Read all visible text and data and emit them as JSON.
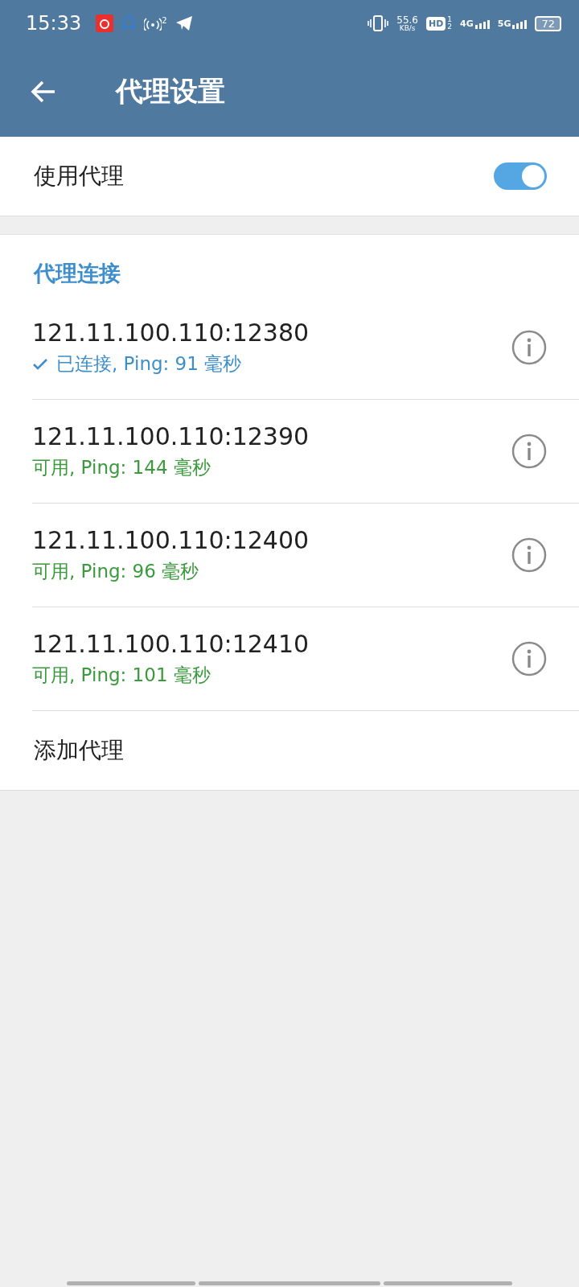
{
  "status_bar": {
    "time": "15:33",
    "hotspot_count": "2",
    "net_speed": "55.6",
    "net_unit": "KB/s",
    "hd_label": "HD",
    "hd_sims": [
      "1",
      "2"
    ],
    "networks": [
      "4G",
      "5G"
    ],
    "battery": "72"
  },
  "app_bar": {
    "title": "代理设置"
  },
  "use_proxy": {
    "label": "使用代理",
    "on": true
  },
  "proxy_section": {
    "title": "代理连接",
    "proxies": [
      {
        "address": "121.11.100.110:12380",
        "status": "已连接, Ping: 91 毫秒",
        "kind": "connected"
      },
      {
        "address": "121.11.100.110:12390",
        "status": "可用, Ping: 144 毫秒",
        "kind": "available"
      },
      {
        "address": "121.11.100.110:12400",
        "status": "可用, Ping: 96 毫秒",
        "kind": "available"
      },
      {
        "address": "121.11.100.110:12410",
        "status": "可用, Ping: 101 毫秒",
        "kind": "available"
      }
    ],
    "add_label": "添加代理"
  }
}
